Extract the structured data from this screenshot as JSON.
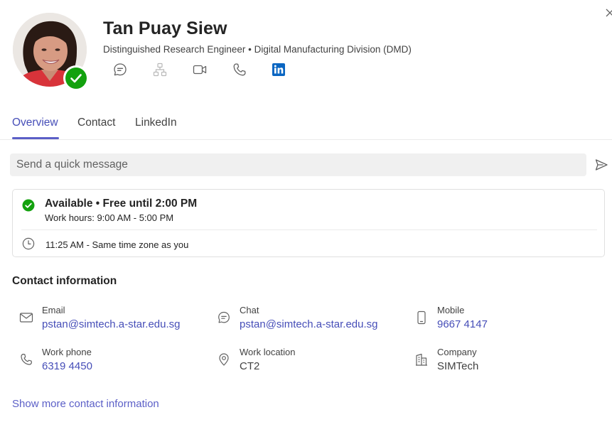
{
  "profile": {
    "name": "Tan Puay Siew",
    "subtitle": "Distinguished Research Engineer • Digital Manufacturing Division (DMD)",
    "presence": "available"
  },
  "header_actions": [
    {
      "icon": "chat-icon"
    },
    {
      "icon": "org-chart-icon",
      "disabled": true
    },
    {
      "icon": "video-call-icon"
    },
    {
      "icon": "phone-icon"
    },
    {
      "icon": "linkedin-icon"
    }
  ],
  "tabs": [
    {
      "label": "Overview",
      "active": true
    },
    {
      "label": "Contact"
    },
    {
      "label": "LinkedIn"
    }
  ],
  "quick_message": {
    "placeholder": "Send a quick message"
  },
  "status": {
    "availability": "Available • Free until 2:00 PM",
    "work_hours": "Work hours: 9:00 AM - 5:00 PM",
    "local_time": "11:25 AM - Same time zone as you"
  },
  "contact": {
    "title": "Contact information",
    "fields": [
      {
        "icon": "mail-icon",
        "label": "Email",
        "value": "pstan@simtech.a-star.edu.sg",
        "link": true
      },
      {
        "icon": "chat-icon",
        "label": "Chat",
        "value": "pstan@simtech.a-star.edu.sg",
        "link": true
      },
      {
        "icon": "mobile-icon",
        "label": "Mobile",
        "value": "9667 4147",
        "link": true
      },
      {
        "icon": "phone-icon",
        "label": "Work phone",
        "value": "6319 4450",
        "link": true
      },
      {
        "icon": "location-icon",
        "label": "Work location",
        "value": "CT2",
        "link": false
      },
      {
        "icon": "building-icon",
        "label": "Company",
        "value": "SIMTech",
        "link": false
      }
    ],
    "show_more": "Show more contact information"
  },
  "colors": {
    "accent": "#5b5fc7",
    "link": "#464eb8",
    "presence_available": "#13a10e",
    "linkedin": "#0a66c2"
  }
}
